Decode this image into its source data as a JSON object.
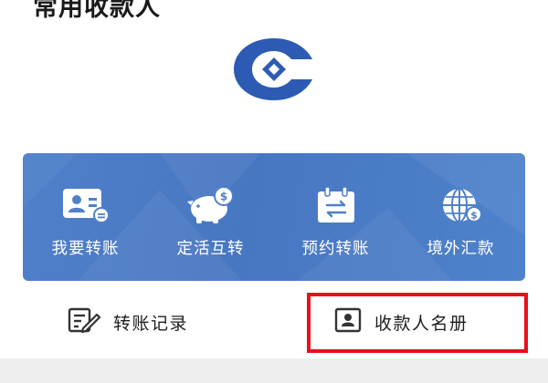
{
  "section": {
    "title": "常用收款人"
  },
  "logo": {
    "icon": "bank-logo-icon",
    "color": "#2d5bb4"
  },
  "actions_panel": {
    "background": "#4f7fc7",
    "items": [
      {
        "label": "我要转账",
        "icon": "transfer-card-icon"
      },
      {
        "label": "定活互转",
        "icon": "piggy-bank-icon"
      },
      {
        "label": "预约转账",
        "icon": "scheduled-calendar-icon"
      },
      {
        "label": "境外汇款",
        "icon": "globe-remittance-icon"
      }
    ]
  },
  "links": {
    "transfer_records": {
      "label": "转账记录",
      "icon": "edit-list-icon"
    },
    "payee_directory": {
      "label": "收款人名册",
      "icon": "contact-card-icon"
    }
  },
  "highlight": {
    "color": "#e8101a",
    "target": "payee_directory"
  }
}
